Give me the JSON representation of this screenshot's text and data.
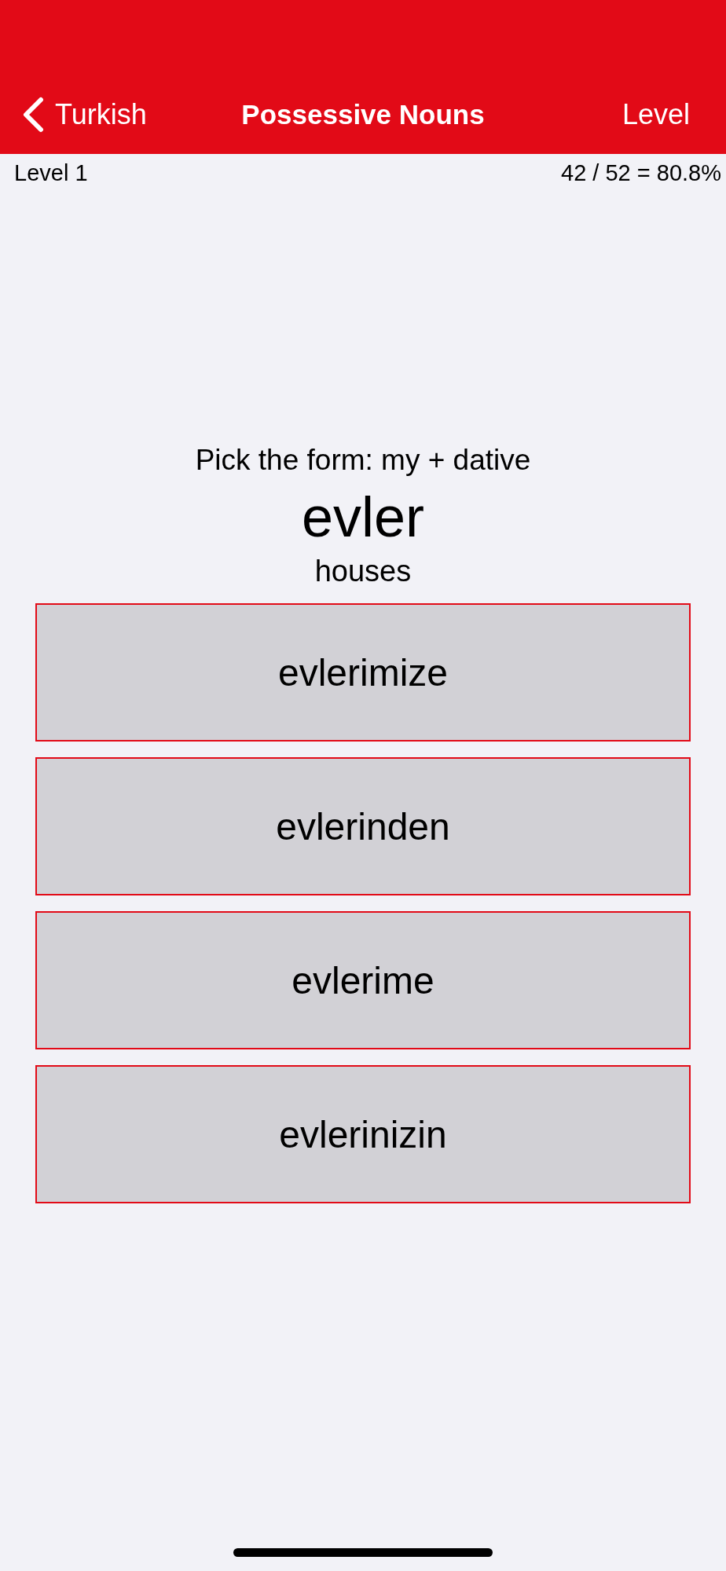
{
  "nav": {
    "back_label": "Turkish",
    "title": "Possessive Nouns",
    "right_button": "Level"
  },
  "stats": {
    "level": "Level 1",
    "score": "42 / 52 = 80.8%"
  },
  "question": {
    "prompt": "Pick the form: my + dative",
    "word": "evler",
    "translation": "houses"
  },
  "answers": [
    {
      "label": "evlerimize"
    },
    {
      "label": "evlerinden"
    },
    {
      "label": "evlerime"
    },
    {
      "label": "evlerinizin"
    }
  ]
}
